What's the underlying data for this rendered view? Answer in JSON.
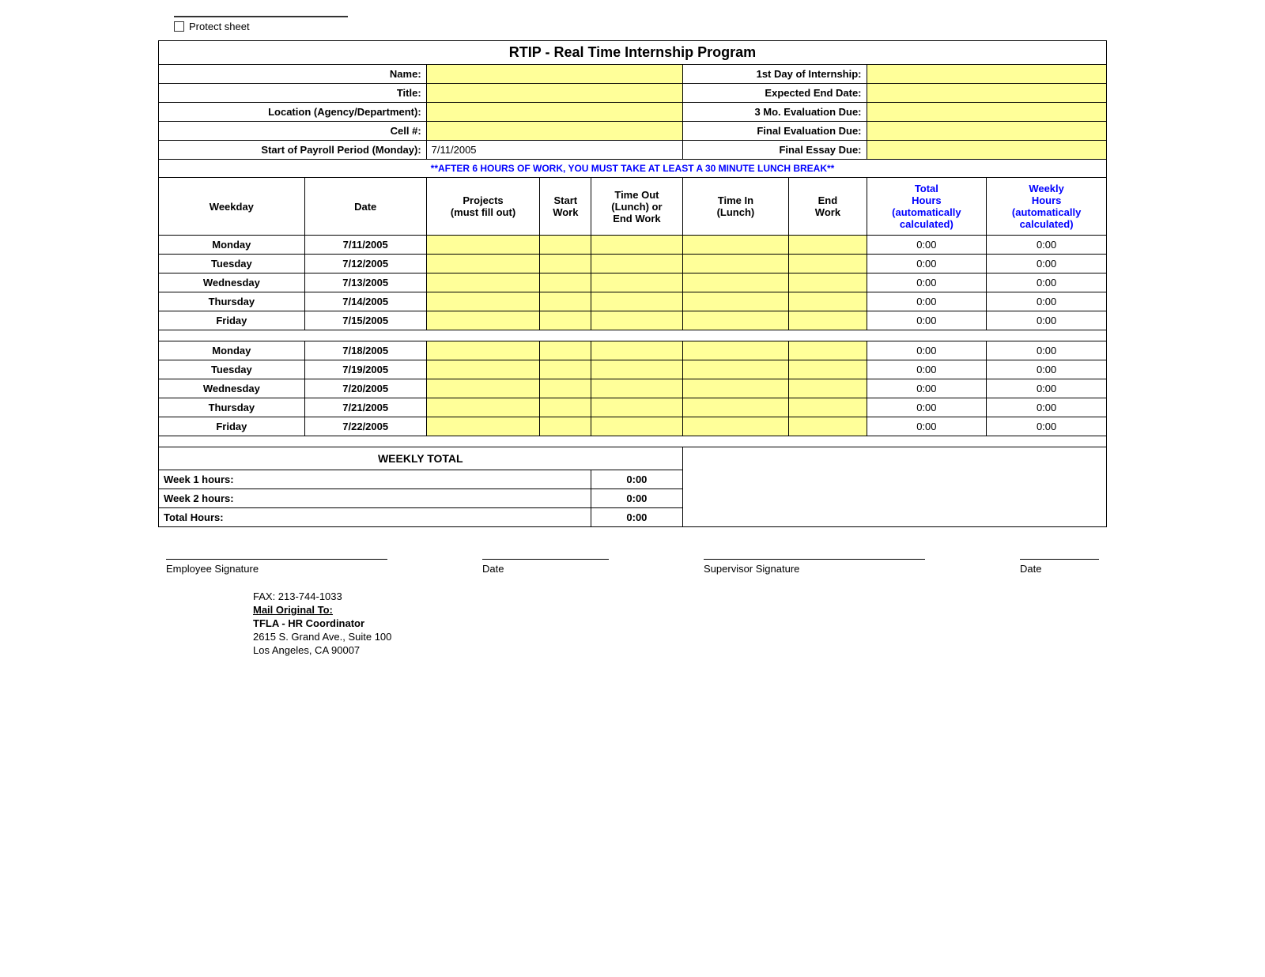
{
  "page": {
    "protect_label": "Protect sheet",
    "title": "RTIP - Real Time Internship Program",
    "fields": {
      "name_label": "Name:",
      "title_label": "Title:",
      "location_label": "Location (Agency/Department):",
      "cell_label": "Cell #:",
      "payroll_label": "Start of Payroll Period (Monday):",
      "payroll_value": "7/11/2005",
      "internship_label": "1st Day of Internship:",
      "end_date_label": "Expected End Date:",
      "eval_3mo_label": "3 Mo. Evaluation Due:",
      "final_eval_label": "Final Evaluation Due:",
      "essay_label": "Final Essay Due:"
    },
    "warning": "**AFTER 6 HOURS OF WORK, YOU MUST TAKE AT LEAST A 30 MINUTE LUNCH BREAK**",
    "columns": {
      "weekday": "Weekday",
      "date": "Date",
      "projects": "Projects\n(must fill out)",
      "start_work": "Start\nWork",
      "time_out": "Time Out\n(Lunch) or\nEnd Work",
      "time_in": "Time In\n(Lunch)",
      "end_work": "End\nWork",
      "total_hours": "Total\nHours\n(automatically\ncalculated)",
      "weekly_hours": "Weekly\nHours\n(automatically\ncalculated)"
    },
    "week1": [
      {
        "weekday": "Monday",
        "date": "7/11/2005",
        "total": "0:00",
        "weekly": "0:00"
      },
      {
        "weekday": "Tuesday",
        "date": "7/12/2005",
        "total": "0:00",
        "weekly": "0:00"
      },
      {
        "weekday": "Wednesday",
        "date": "7/13/2005",
        "total": "0:00",
        "weekly": "0:00"
      },
      {
        "weekday": "Thursday",
        "date": "7/14/2005",
        "total": "0:00",
        "weekly": "0:00"
      },
      {
        "weekday": "Friday",
        "date": "7/15/2005",
        "total": "0:00",
        "weekly": "0:00"
      }
    ],
    "week2": [
      {
        "weekday": "Monday",
        "date": "7/18/2005",
        "total": "0:00",
        "weekly": "0:00"
      },
      {
        "weekday": "Tuesday",
        "date": "7/19/2005",
        "total": "0:00",
        "weekly": "0:00"
      },
      {
        "weekday": "Wednesday",
        "date": "7/20/2005",
        "total": "0:00",
        "weekly": "0:00"
      },
      {
        "weekday": "Thursday",
        "date": "7/21/2005",
        "total": "0:00",
        "weekly": "0:00"
      },
      {
        "weekday": "Friday",
        "date": "7/22/2005",
        "total": "0:00",
        "weekly": "0:00"
      }
    ],
    "weekly_total_label": "WEEKLY TOTAL",
    "week1_hours_label": "Week 1 hours:",
    "week1_hours_value": "0:00",
    "week2_hours_label": "Week 2 hours:",
    "week2_hours_value": "0:00",
    "total_hours_label": "Total Hours:",
    "total_hours_value": "0:00",
    "signature": {
      "employee_label": "Employee Signature",
      "date_label1": "Date",
      "supervisor_label": "Supervisor Signature",
      "date_label2": "Date"
    },
    "footer": {
      "fax": "FAX:  213-744-1033",
      "mail_label": "Mail Original To:",
      "org": "TFLA - HR Coordinator",
      "address1": "2615 S. Grand Ave., Suite 100",
      "address2": "Los Angeles, CA 90007"
    }
  }
}
